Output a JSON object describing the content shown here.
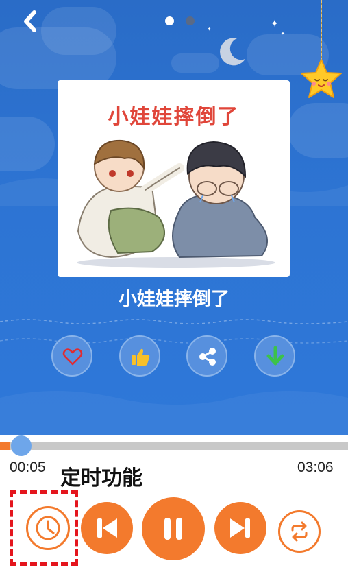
{
  "pager": {
    "pages": 2,
    "current": 1
  },
  "cover": {
    "caption": "小娃娃摔倒了"
  },
  "song": {
    "title": "小娃娃摔倒了"
  },
  "actions": [
    {
      "name": "favorite",
      "icon": "heart-icon"
    },
    {
      "name": "like",
      "icon": "thumbs-up-icon"
    },
    {
      "name": "share",
      "icon": "share-icon"
    },
    {
      "name": "download",
      "icon": "download-icon"
    }
  ],
  "player": {
    "current_time": "00:05",
    "total_time": "03:06",
    "progress_fraction": 0.027
  },
  "annotation": {
    "text": "定时功能"
  },
  "controls": [
    {
      "name": "timer",
      "icon": "clock-icon"
    },
    {
      "name": "previous",
      "icon": "previous-icon"
    },
    {
      "name": "pause",
      "icon": "pause-icon"
    },
    {
      "name": "next",
      "icon": "next-icon"
    },
    {
      "name": "repeat",
      "icon": "repeat-icon"
    }
  ],
  "colors": {
    "background_blue": "#2d74d3",
    "accent_orange": "#f37a2d",
    "thumb_blue": "#6ea6ea",
    "highlight_red": "#e4151d"
  }
}
